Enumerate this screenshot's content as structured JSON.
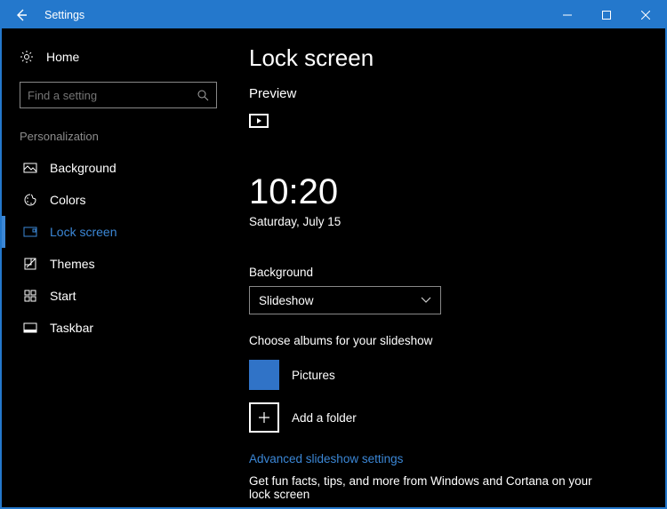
{
  "window": {
    "title": "Settings"
  },
  "sidebar": {
    "home": "Home",
    "search_placeholder": "Find a setting",
    "section": "Personalization",
    "items": [
      {
        "label": "Background"
      },
      {
        "label": "Colors"
      },
      {
        "label": "Lock screen"
      },
      {
        "label": "Themes"
      },
      {
        "label": "Start"
      },
      {
        "label": "Taskbar"
      }
    ]
  },
  "main": {
    "title": "Lock screen",
    "preview_label": "Preview",
    "clock": "10:20",
    "date": "Saturday, July 15",
    "background_label": "Background",
    "background_value": "Slideshow",
    "albums_label": "Choose albums for your slideshow",
    "album1": "Pictures",
    "add_folder": "Add a folder",
    "advanced_link": "Advanced slideshow settings",
    "tip_text": "Get fun facts, tips, and more from Windows and Cortana on your lock screen"
  }
}
